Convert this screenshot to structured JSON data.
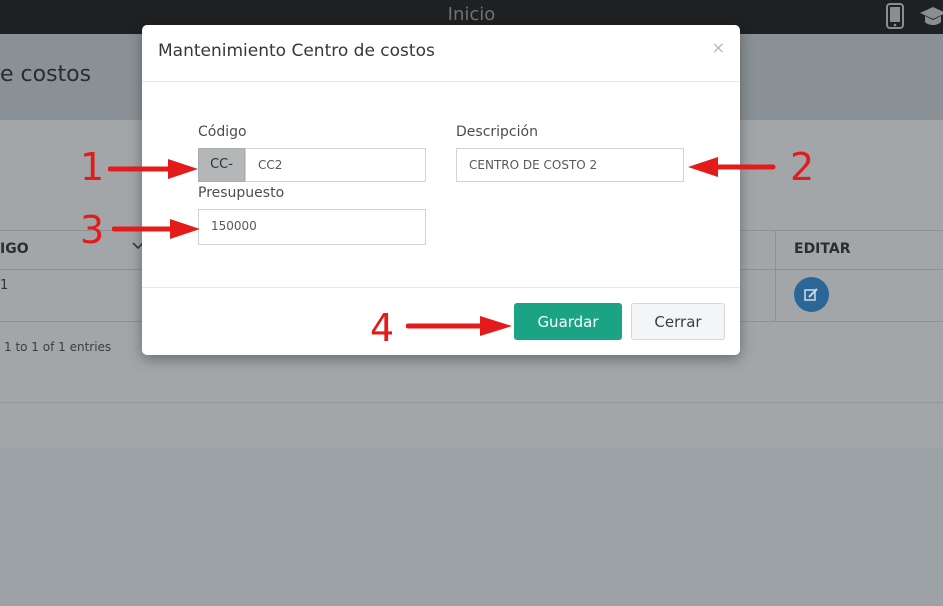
{
  "topbar": {
    "title": "Inicio",
    "icons": [
      "mobile-icon",
      "graduation-cap-icon"
    ]
  },
  "page": {
    "title": "e costos"
  },
  "table": {
    "headers": [
      "IGO",
      "EDITAR"
    ],
    "rows": [
      {
        "col1": "1"
      }
    ],
    "info": "1 to 1 of 1 entries"
  },
  "modal": {
    "title": "Mantenimiento Centro de costos",
    "close_symbol": "×",
    "fields": {
      "codigo_label": "Código",
      "codigo_prefix": "CC-",
      "codigo_value": "CC2",
      "descripcion_label": "Descripción",
      "descripcion_value": "CENTRO DE COSTO 2",
      "presupuesto_label": "Presupuesto",
      "presupuesto_value": "150000"
    },
    "buttons": {
      "save": "Guardar",
      "close": "Cerrar"
    }
  },
  "annotations": [
    "1",
    "2",
    "3",
    "4"
  ],
  "colors": {
    "save_button": "#1aa385",
    "annotation": "#e31b1b",
    "topbar": "#1e2022"
  }
}
